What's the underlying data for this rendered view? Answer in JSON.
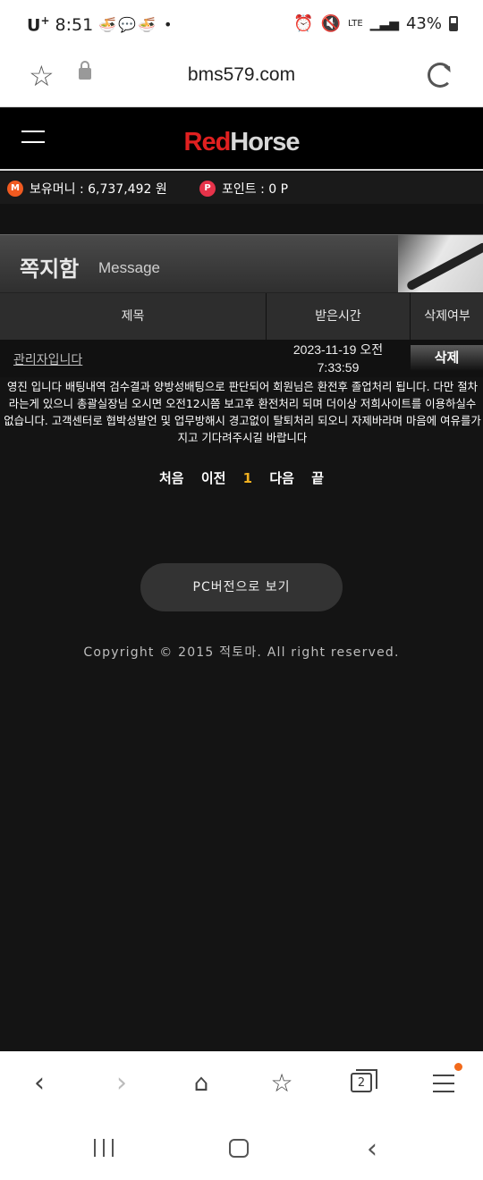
{
  "status_bar": {
    "carrier": "U",
    "carrier_sup": "+",
    "time": "8:51",
    "battery": "43%",
    "network": "LTE"
  },
  "browser": {
    "url": "bms579.com"
  },
  "site": {
    "logo_red": "Red",
    "logo_gray": "Horse",
    "money_label": "보유머니 : 6,737,492 원",
    "point_label": "포인트 : 0 P"
  },
  "page": {
    "title_kr": "쪽지함",
    "title_en": "Message"
  },
  "table": {
    "headers": [
      "제목",
      "받은시간",
      "삭제여부"
    ],
    "row": {
      "subject": "관리자입니다",
      "time_line1": "2023-11-19 오전",
      "time_line2": "7:33:59",
      "delete_label": "삭제"
    }
  },
  "message_body": "영진 입니다 배팅내역 검수결과 양방성배팅으로 판단되어 회원님은 환전후 졸업처리 됩니다. 다만 절차라는게 있으니 총괄실장님 오시면 오전12시쯤 보고후 환전처리 되며 더이상 저희사이트를 이용하실수 없습니다. 고객센터로 협박성발언 및 업무방해시 경고없이 탈퇴처리 되오니 자제바라며 마음에 여유를가지고 기다려주시길 바랍니다",
  "pagination": {
    "first": "처음",
    "prev": "이전",
    "current": "1",
    "next": "다음",
    "last": "끝"
  },
  "pc_version_label": "PC버전으로 보기",
  "copyright": "Copyright © 2015 적토마. All right reserved.",
  "toolbar": {
    "tabs_count": "2"
  }
}
